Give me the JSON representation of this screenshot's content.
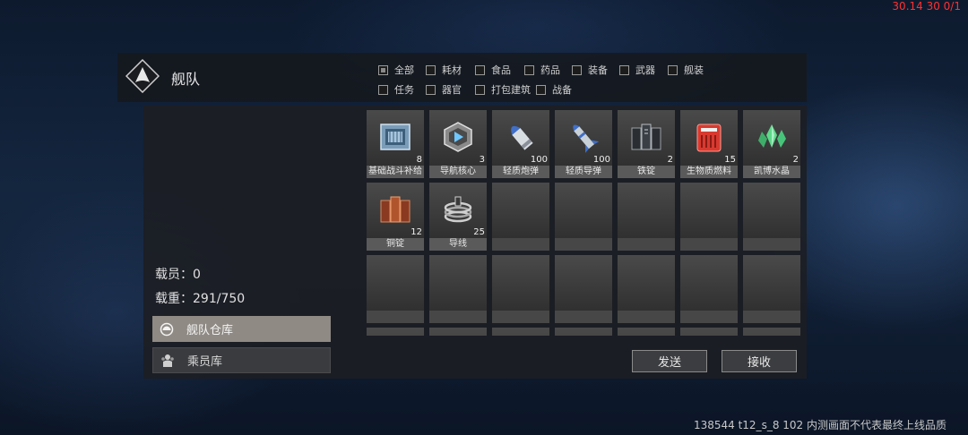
{
  "debug": {
    "fps_text": "30.14 30 0/1"
  },
  "header": {
    "title": "舰队"
  },
  "filters": [
    {
      "label": "全部",
      "checked": true
    },
    {
      "label": "耗材",
      "checked": false
    },
    {
      "label": "食品",
      "checked": false
    },
    {
      "label": "药品",
      "checked": false
    },
    {
      "label": "装备",
      "checked": false
    },
    {
      "label": "武器",
      "checked": false
    },
    {
      "label": "舰装",
      "checked": false
    },
    {
      "label": "任务",
      "checked": false
    },
    {
      "label": "器官",
      "checked": false
    },
    {
      "label": "打包建筑",
      "checked": false
    },
    {
      "label": "战备",
      "checked": false
    }
  ],
  "stats": {
    "crew": "载员：0",
    "weight": "载重：291/750"
  },
  "sidebar": {
    "fleet_storage": "舰队仓库",
    "crew_storage": "乘员库"
  },
  "items": [
    {
      "name": "基础战斗补给",
      "count": "8",
      "icon": "supply-crate-icon"
    },
    {
      "name": "导航核心",
      "count": "3",
      "icon": "nav-core-icon"
    },
    {
      "name": "轻质炮弹",
      "count": "100",
      "icon": "shell-icon"
    },
    {
      "name": "轻质导弹",
      "count": "100",
      "icon": "missile-icon"
    },
    {
      "name": "铁锭",
      "count": "2",
      "icon": "iron-ingot-icon"
    },
    {
      "name": "生物质燃料",
      "count": "15",
      "icon": "biofuel-icon"
    },
    {
      "name": "凯博水晶",
      "count": "2",
      "icon": "crystal-icon"
    },
    {
      "name": "铜锭",
      "count": "12",
      "icon": "copper-ingot-icon"
    },
    {
      "name": "导线",
      "count": "25",
      "icon": "wire-icon"
    }
  ],
  "buttons": {
    "send": "发送",
    "receive": "接收"
  },
  "footer": {
    "text": "138544 t12_s_8 102  内测画面不代表最终上线品质"
  }
}
